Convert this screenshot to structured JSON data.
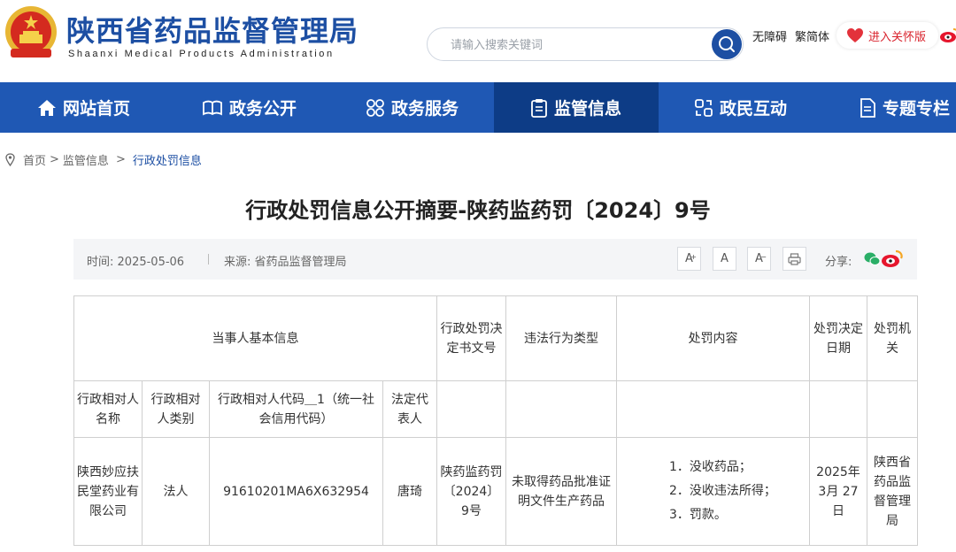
{
  "header": {
    "title": "陕西省药品监督管理局",
    "subtitle": "Shaanxi Medical Products Administration",
    "search_placeholder": "请输入搜索关键词",
    "accessibility": "无障碍",
    "trad_simp": "繁简体",
    "care_mode": "进入关怀版"
  },
  "nav": {
    "items": [
      {
        "label": "网站首页",
        "icon": "home-icon"
      },
      {
        "label": "政务公开",
        "icon": "book-icon"
      },
      {
        "label": "政务服务",
        "icon": "grid-icon"
      },
      {
        "label": "监管信息",
        "icon": "clipboard-icon",
        "active": true
      },
      {
        "label": "政民互动",
        "icon": "interaction-icon"
      },
      {
        "label": "专题专栏",
        "icon": "document-icon"
      }
    ]
  },
  "breadcrumb": {
    "home": "首页",
    "sep1": ">",
    "level1": "监管信息",
    "sep2": ">",
    "current": "行政处罚信息"
  },
  "article": {
    "title": "行政处罚信息公开摘要-陕药监药罚〔2024〕9号",
    "time_label": "时间:",
    "time": "2025-05-06",
    "source_label": "来源:",
    "source": "省药品监督管理局",
    "font_large": "A",
    "font_normal": "A",
    "font_small": "A",
    "share_label": "分享:"
  },
  "table": {
    "header": {
      "party_info": "当事人基本信息",
      "decision_no": "行政处罚决定书文号",
      "violation_type": "违法行为类型",
      "punishment": "处罚内容",
      "decision_date": "处罚决定日期",
      "authority": "处罚机关"
    },
    "subheader": {
      "name": "行政相对人名称",
      "category": "行政相对人类别",
      "code": "行政相对人代码＿1（统一社会信用代码）",
      "legal_rep": "法定代表人"
    },
    "row": {
      "name": "陕西妙应扶民堂药业有限公司",
      "category": "法人",
      "code": "91610201MA6X632954",
      "legal_rep": "唐琦",
      "decision_no": "陕药监药罚〔2024〕9号",
      "violation_type": "未取得药品批准证明文件生产药品",
      "punishment": [
        "1．没收药品；",
        "2．没收违法所得；",
        "3．罚款。"
      ],
      "decision_date": "2025年3月 27日",
      "authority": "陕西省药品监督管理局"
    }
  },
  "colors": {
    "brand_blue": "#1f58b4",
    "nav_active": "#0d3c86",
    "care_red": "#d9232d"
  }
}
